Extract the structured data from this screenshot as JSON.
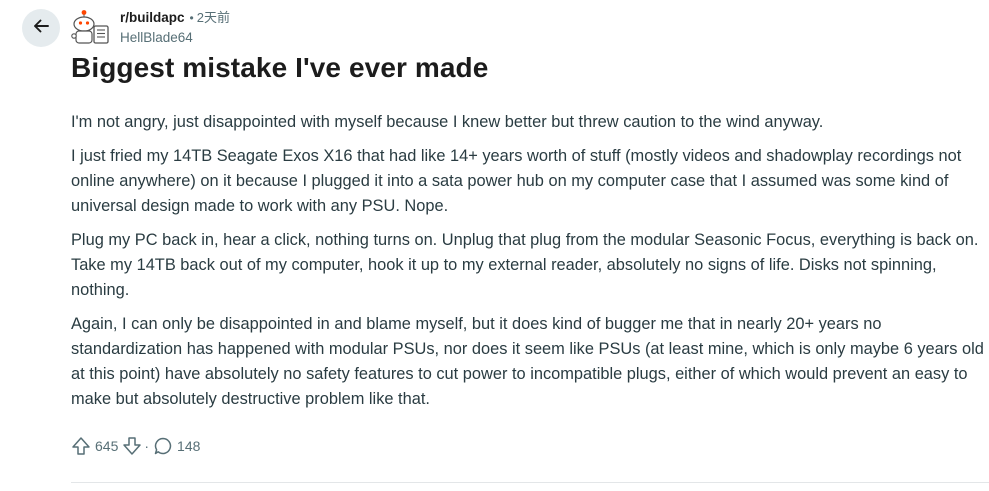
{
  "header": {
    "subreddit": "r/buildapc",
    "separator": "•",
    "time": "2天前",
    "author": "HellBlade64"
  },
  "post": {
    "title": "Biggest mistake I've ever made",
    "paragraphs": [
      "I'm not angry, just disappointed with myself because I knew better but threw caution to the wind anyway.",
      "I just fried my 14TB Seagate Exos X16 that had like 14+ years worth of stuff (mostly videos and shadowplay recordings not online anywhere) on it because I plugged it into a sata power hub on my computer case that I assumed was some kind of universal design made to work with any PSU. Nope.",
      "Plug my PC back in, hear a click, nothing turns on. Unplug that plug from the modular Seasonic Focus, everything is back on. Take my 14TB back out of my computer, hook it up to my external reader, absolutely no signs of life. Disks not spinning, nothing.",
      "Again, I can only be disappointed in and blame myself, but it does kind of bugger me that in nearly 20+ years no standardization has happened with modular PSUs, nor does it seem like PSUs (at least mine, which is only maybe 6 years old at this point) have absolutely no safety features to cut power to incompatible plugs, either of which would prevent an easy to make but absolutely destructive problem like that."
    ]
  },
  "actions": {
    "upvotes": "645",
    "separator": "·",
    "comments": "148"
  },
  "icons": {
    "back": "arrow-left-icon",
    "avatar": "subreddit-avatar-icon",
    "upvote": "upvote-arrow-icon",
    "downvote": "downvote-arrow-icon",
    "comments": "comment-bubble-icon"
  },
  "colors": {
    "back_button_bg": "#e5ebee",
    "muted_text": "#576f76",
    "body_text": "#2a3c42",
    "title_text": "#1c1c1c"
  }
}
